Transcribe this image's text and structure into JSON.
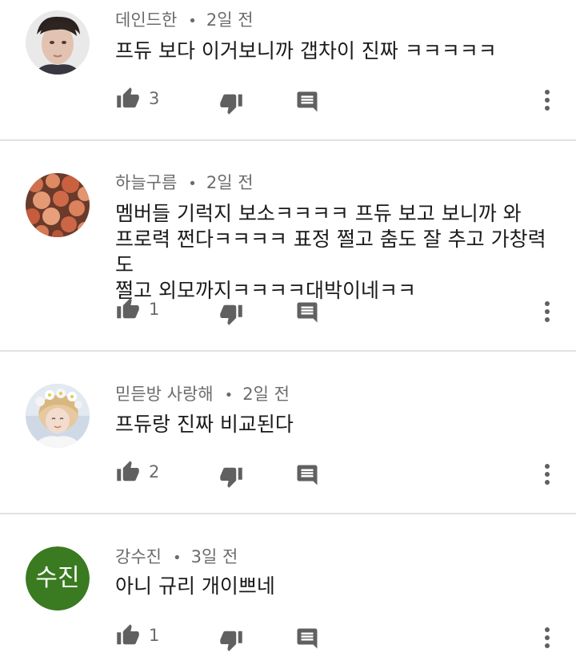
{
  "comments": [
    {
      "author": "데인드한",
      "time": "2일 전",
      "text": "프듀 보다 이거보니까 갭차이 진짜 ㅋㅋㅋㅋㅋ",
      "likes": "3",
      "avatar_icon": "person-photo"
    },
    {
      "author": "하늘구름",
      "time": "2일 전",
      "text": "멤버들 기럭지 보소ㅋㅋㅋㅋ 프듀 보고 보니까 와\n프로력 쩐다ㅋㅋㅋㅋ 표정 쩔고 춤도 잘 추고 가창력도\n쩔고 외모까지ㅋㅋㅋㅋ대박이네ㅋㅋ",
      "likes": "1",
      "avatar_icon": "flowers-photo"
    },
    {
      "author": "믿듣방 사랑해",
      "time": "2일 전",
      "text": "프듀랑 진짜 비교된다",
      "likes": "2",
      "avatar_icon": "person-flower-crown-photo"
    },
    {
      "author": "강수진",
      "time": "3일 전",
      "text": "아니 규리 개이쁘네",
      "likes": "1",
      "avatar_initials": "수진",
      "avatar_color": "#3a7a20"
    }
  ],
  "dot_separator": "•",
  "colors": {
    "meta_text": "#6b6b6b",
    "body_text": "#1a1a1a",
    "icon": "#606060",
    "divider": "#e2e2e2"
  }
}
